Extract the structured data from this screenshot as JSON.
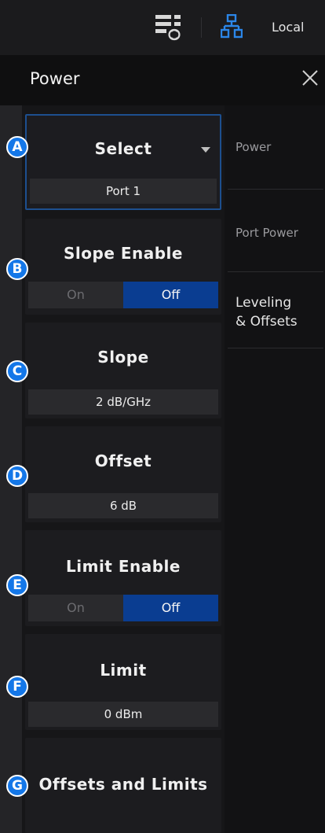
{
  "topbar": {
    "local_label": "Local"
  },
  "header": {
    "title": "Power"
  },
  "cards": {
    "select": {
      "title": "Select",
      "value": "Port 1"
    },
    "slope_enable": {
      "title": "Slope Enable",
      "on": "On",
      "off": "Off",
      "selected": "Off"
    },
    "slope": {
      "title": "Slope",
      "value": "2 dB/GHz"
    },
    "offset": {
      "title": "Offset",
      "value": "6 dB"
    },
    "limit_enable": {
      "title": "Limit Enable",
      "on": "On",
      "off": "Off",
      "selected": "Off"
    },
    "limit": {
      "title": "Limit",
      "value": "0 dBm"
    },
    "offsets_limits": {
      "title": "Offsets and Limits"
    }
  },
  "badges": [
    "A",
    "B",
    "C",
    "D",
    "E",
    "F",
    "G"
  ],
  "side_nav": {
    "power": "Power",
    "port_power": "Port Power",
    "leveling_line1": "Leveling",
    "leveling_line2": "& Offsets"
  },
  "colors": {
    "accent": "#0a3d91",
    "badge": "#1477e8",
    "selection_border": "#1d4f8f"
  }
}
